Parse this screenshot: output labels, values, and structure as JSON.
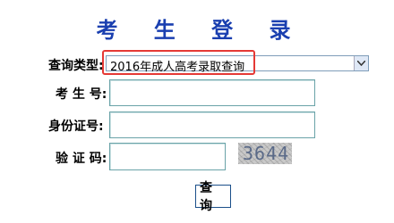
{
  "title": "考 生 登 录",
  "query_type": {
    "label": "查询类型:",
    "selected": "2016年成人高考录取查询"
  },
  "exam_number": {
    "label": "考 生 号:",
    "value": ""
  },
  "id_number": {
    "label": "身份证号:",
    "value": ""
  },
  "captcha": {
    "label": "验 证 码:",
    "value": "",
    "image_text": "3644"
  },
  "submit_label": "查 询",
  "colors": {
    "title": "#1a3fb0",
    "highlight": "#e53935",
    "input_border": "#6aa3a8"
  }
}
